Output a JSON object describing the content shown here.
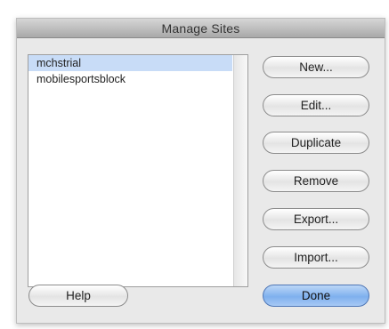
{
  "dialog": {
    "title": "Manage Sites"
  },
  "sites": {
    "items": [
      {
        "label": "mchstrial",
        "selected": true
      },
      {
        "label": "mobilesportsblock",
        "selected": false
      }
    ]
  },
  "buttons": {
    "new_label": "New...",
    "edit_label": "Edit...",
    "duplicate_label": "Duplicate",
    "remove_label": "Remove",
    "export_label": "Export...",
    "import_label": "Import...",
    "help_label": "Help",
    "done_label": "Done"
  },
  "colors": {
    "selection": "#c8dcf7",
    "default_button": "#7fb0ee"
  }
}
